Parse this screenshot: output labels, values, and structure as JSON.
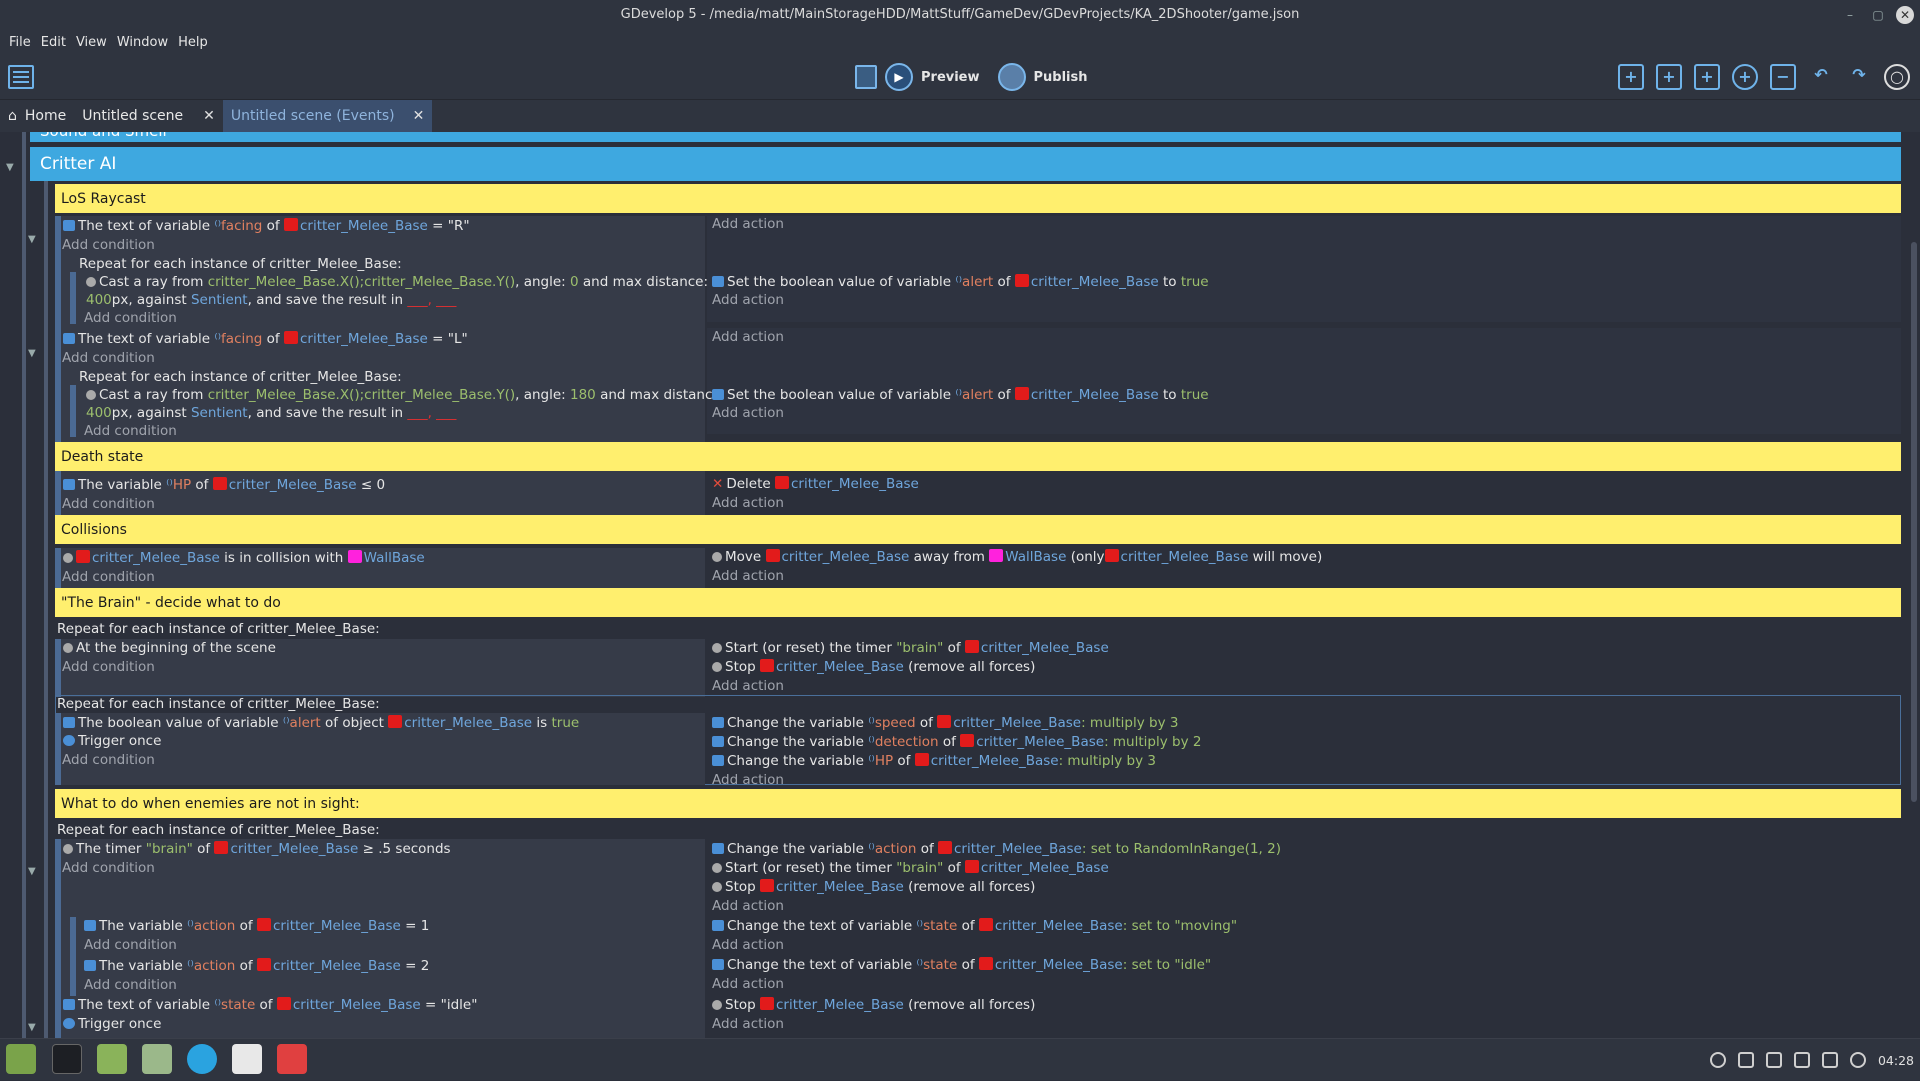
{
  "window": {
    "title": "GDevelop 5 - /media/matt/MainStorageHDD/MattStuff/GameDev/GDevProjects/KA_2DShooter/game.json"
  },
  "menu": [
    "File",
    "Edit",
    "View",
    "Window",
    "Help"
  ],
  "toolbar": {
    "preview": "Preview",
    "publish": "Publish"
  },
  "tabs": [
    {
      "label": "Home"
    },
    {
      "label": "Untitled scene"
    },
    {
      "label": "Untitled scene (Events)"
    }
  ],
  "groups": {
    "top_partial": "Sound and Smell",
    "critter_ai": "Critter AI"
  },
  "add_condition": "Add condition",
  "add_action": "Add action",
  "repeat_each": "Repeat for each instance of critter_Melee_Base:",
  "obj": {
    "critter": "critter_Melee_Base",
    "wall": "WallBase",
    "sentient": "Sentient"
  },
  "comments": {
    "los": "LoS Raycast",
    "death": "Death state",
    "collisions": "Collisions",
    "brain": "\"The Brain\" - decide what to do",
    "notsight": "What to do when enemies are not in sight:"
  },
  "t": {
    "text_of_var": "The text of variable",
    "of": "of",
    "facing": "facing",
    "eq_R": "= \"R\"",
    "eq_L": "= \"L\"",
    "cast_ray_from": "Cast a ray from",
    "ray_pos": "critter_Melee_Base.X();critter_Melee_Base.Y()",
    ", angle:": ", angle:",
    "angle0": "0",
    "angle180": "180",
    "and_max": "and max distance:",
    "dist": "400",
    "px_against": "px, against",
    "save_result": ", and save the result in",
    "set_bool": "Set the boolean value of variable",
    "alert": "alert",
    "to": "to",
    "true": "true",
    "the_variable": "The variable",
    "hp": "HP",
    "le0": "≤ 0",
    "delete": "Delete",
    "in_collision": "is in collision with",
    "move": "Move",
    "away_from": "away from",
    "only_open": "(only",
    "will_move": "will move)",
    "begin_scene": "At the beginning of the scene",
    "start_timer": "Start (or reset) the timer",
    "brain": "\"brain\"",
    "stop": "Stop",
    "remove_forces": "(remove all forces)",
    "bool_of_var": "The boolean value of variable",
    "of_object": "of object",
    "is": "is",
    "trigger_once": "Trigger once",
    "change_var": "Change the variable",
    "speed": "speed",
    "detection": "detection",
    "colon_mult3": ": multiply by 3",
    "colon_mult2": ": multiply by 2",
    "the_timer": "The timer",
    "ge5": "≥ .5 seconds",
    "action": "action",
    "set_random": ": set to RandomInRange(1, 2)",
    "eq1": "= 1",
    "eq2": "= 2",
    "change_text_var": "Change the text of variable",
    "state": "state",
    "set_moving": ": set to \"moving\"",
    "set_idle": ": set to \"idle\"",
    "eq_idle": "= \"idle\""
  },
  "taskbar": {
    "clock": "04:28"
  }
}
